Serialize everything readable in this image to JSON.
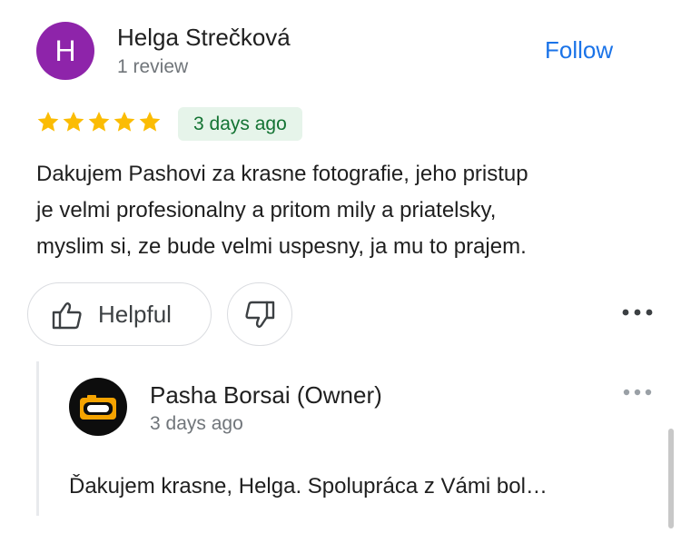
{
  "review": {
    "avatar_letter": "H",
    "avatar_color": "#8e24aa",
    "author": "Helga Strečková",
    "review_count": "1 review",
    "follow_label": "Follow",
    "rating": 5,
    "date": "3 days ago",
    "text_lines": [
      "Dakujem Pashovi za krasne fotografie, jeho pristup",
      "je velmi profesionalny a pritom mily a priatelsky,",
      "myslim si, ze bude velmi uspesny, ja mu to prajem."
    ]
  },
  "actions": {
    "helpful_label": "Helpful",
    "helpful_icon": "thumbs-up-icon",
    "not_helpful_icon": "thumbs-down-icon",
    "more_icon": "more-horizontal-icon"
  },
  "owner_reply": {
    "name": "Pasha Borsai (Owner)",
    "date": "3 days ago",
    "text": "Ďakujem krasne, Helga. Spolupráca z Vámi bol…",
    "logo_icon": "camera-logo-icon"
  },
  "colors": {
    "link": "#1a73e8",
    "star": "#fbbc04",
    "date_chip_bg": "#e6f4ea",
    "date_chip_text": "#137333"
  }
}
